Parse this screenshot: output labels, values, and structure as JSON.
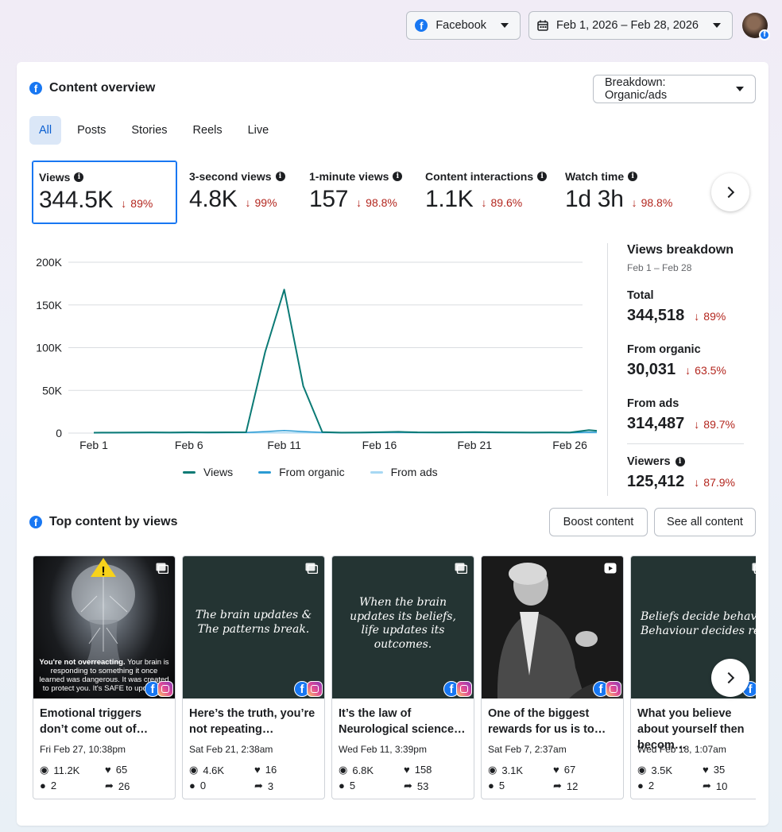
{
  "topbar": {
    "platform": "Facebook",
    "date_range": "Feb 1, 2026 – Feb 28, 2026"
  },
  "overview": {
    "title": "Content overview",
    "breakdown_label": "Breakdown: Organic/ads",
    "tabs": [
      {
        "label": "All",
        "active": true
      },
      {
        "label": "Posts",
        "active": false
      },
      {
        "label": "Stories",
        "active": false
      },
      {
        "label": "Reels",
        "active": false
      },
      {
        "label": "Live",
        "active": false
      }
    ],
    "metrics": [
      {
        "label": "Views",
        "value": "344.5K",
        "delta": "89%",
        "selected": true
      },
      {
        "label": "3-second views",
        "value": "4.8K",
        "delta": "99%"
      },
      {
        "label": "1-minute views",
        "value": "157",
        "delta": "98.8%"
      },
      {
        "label": "Content interactions",
        "value": "1.1K",
        "delta": "89.6%"
      },
      {
        "label": "Watch time",
        "value": "1d 3h",
        "delta": "98.8%"
      }
    ]
  },
  "chart_data": {
    "type": "line",
    "x": [
      1,
      2,
      3,
      4,
      5,
      6,
      7,
      8,
      9,
      10,
      11,
      12,
      13,
      14,
      15,
      16,
      17,
      18,
      19,
      20,
      21,
      22,
      23,
      24,
      25,
      26,
      27,
      28
    ],
    "xticks": [
      "Feb 1",
      "Feb 6",
      "Feb 11",
      "Feb 16",
      "Feb 21",
      "Feb 26"
    ],
    "xtick_positions": [
      1,
      6,
      11,
      16,
      21,
      26
    ],
    "yticks": [
      "0",
      "50K",
      "100K",
      "150K",
      "200K"
    ],
    "ytick_values": [
      0,
      50000,
      100000,
      150000,
      200000
    ],
    "ylim": [
      0,
      200000
    ],
    "series": [
      {
        "name": "Views",
        "color": "#0b7a75",
        "values": [
          500,
          600,
          700,
          800,
          700,
          900,
          800,
          900,
          1000,
          95000,
          168000,
          55000,
          1200,
          600,
          700,
          1000,
          1500,
          900,
          800,
          900,
          1200,
          900,
          800,
          700,
          800,
          700,
          3500,
          1500
        ]
      },
      {
        "name": "From organic",
        "color": "#2b9bd3",
        "values": [
          400,
          500,
          500,
          600,
          500,
          600,
          500,
          600,
          700,
          1800,
          3000,
          1800,
          800,
          500,
          500,
          700,
          900,
          600,
          600,
          600,
          800,
          600,
          600,
          500,
          600,
          500,
          1000,
          900
        ]
      },
      {
        "name": "From ads",
        "color": "#a7d8f3",
        "values": [
          100,
          100,
          200,
          200,
          200,
          300,
          300,
          300,
          300,
          400,
          500,
          400,
          300,
          100,
          200,
          300,
          600,
          300,
          200,
          300,
          400,
          300,
          200,
          200,
          200,
          200,
          300,
          300
        ]
      }
    ],
    "grid": true,
    "legend": "bottom"
  },
  "breakdown": {
    "title": "Views breakdown",
    "subtitle": "Feb 1 – Feb 28",
    "items": [
      {
        "label": "Total",
        "value": "344,518",
        "delta": "89%"
      },
      {
        "label": "From organic",
        "value": "30,031",
        "delta": "63.5%"
      },
      {
        "label": "From ads",
        "value": "314,487",
        "delta": "89.7%"
      },
      {
        "label": "Viewers",
        "value": "125,412",
        "delta": "87.9%"
      }
    ]
  },
  "top_content": {
    "title": "Top content by views",
    "boost_label": "Boost content",
    "see_all_label": "See all content",
    "posts": [
      {
        "title": "Emotional triggers don’t come out of…",
        "date": "Fri Feb 27, 10:38pm",
        "views": "11.2K",
        "likes": "65",
        "comments": "2",
        "shares": "26",
        "overlay_bold": "You're not overreacting.",
        "overlay_text": "Your brain is responding to something it once learned was dangerous. It was created to protect you. It's SAFE to update it.",
        "type_icon": "image-icon"
      },
      {
        "title": "Here’s the truth, you’re not repeating…",
        "date": "Sat Feb 21, 2:38am",
        "views": "4.6K",
        "likes": "16",
        "comments": "0",
        "shares": "3",
        "overlay_lines": [
          "The brain updates &",
          "The patterns break."
        ],
        "type_icon": "image-icon"
      },
      {
        "title": "It’s the law of Neurological science…",
        "date": "Wed Feb 11, 3:39pm",
        "views": "6.8K",
        "likes": "158",
        "comments": "5",
        "shares": "53",
        "overlay_lines": [
          "When the brain",
          "updates its beliefs,",
          "life updates its",
          "outcomes."
        ],
        "type_icon": "image-icon"
      },
      {
        "title": "One of the biggest rewards for us is to…",
        "date": "Sat Feb 7, 2:37am",
        "views": "3.1K",
        "likes": "67",
        "comments": "5",
        "shares": "12",
        "type_icon": "reel-icon"
      },
      {
        "title": "What you believe about yourself then becom…",
        "date": "Wed Feb 18, 1:07am",
        "views": "3.5K",
        "likes": "35",
        "comments": "2",
        "shares": "10",
        "overlay_lines": [
          "Beliefs decide behaviour,",
          "Behaviour decides results."
        ],
        "type_icon": "image-icon"
      }
    ]
  }
}
